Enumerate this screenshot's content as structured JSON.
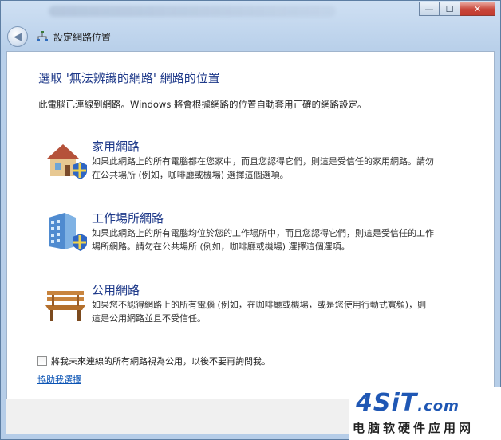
{
  "window": {
    "minimize": "—",
    "maximize": "☐",
    "close": "✕"
  },
  "nav": {
    "back": "◀",
    "title": "設定網路位置"
  },
  "heading": "選取 '無法辨識的網路' 網路的位置",
  "intro": "此電腦已連線到網路。Windows 將會根據網路的位置自動套用正確的網路設定。",
  "options": [
    {
      "title": "家用網路",
      "desc": "如果此網路上的所有電腦都在您家中，而且您認得它們，則這是受信任的家用網路。請勿在公共場所 (例如，咖啡廳或機場) 選擇這個選項。",
      "icon": "home-network-icon"
    },
    {
      "title": "工作場所網路",
      "desc": "如果此網路上的所有電腦均位於您的工作場所中，而且您認得它們，則這是受信任的工作場所網路。請勿在公共場所 (例如，咖啡廳或機場) 選擇這個選項。",
      "icon": "work-network-icon"
    },
    {
      "title": "公用網路",
      "desc": "如果您不認得網路上的所有電腦 (例如，在咖啡廳或機場，或是您使用行動式寬頻)，則這是公用網路並且不受信任。",
      "icon": "public-network-icon"
    }
  ],
  "checkbox": {
    "label": "將我未來連線的所有網路視為公用，以後不要再詢問我。",
    "checked": false
  },
  "help_link": "協助我選擇",
  "watermark": {
    "logo": "4SiT",
    "domain": ".com",
    "subtitle": "电脑软硬件应用网"
  }
}
